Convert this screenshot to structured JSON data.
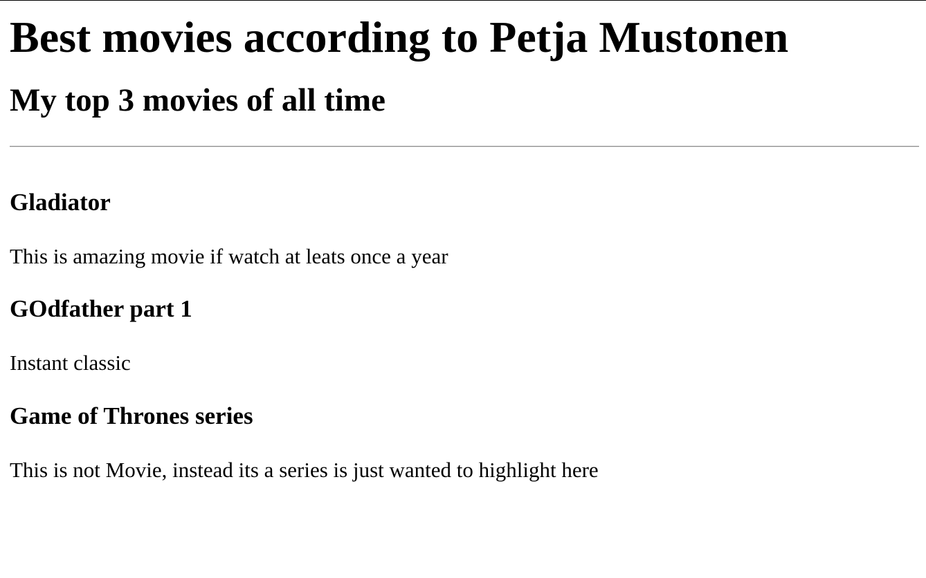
{
  "page": {
    "title": "Best movies according to Petja Mustonen",
    "subtitle": "My top 3 movies of all time"
  },
  "movies": [
    {
      "title": "Gladiator",
      "description": "This is amazing movie if watch at leats once a year"
    },
    {
      "title": "GOdfather part 1",
      "description": "Instant classic"
    },
    {
      "title": "Game of Thrones series",
      "description": "This is not Movie, instead its a series is just wanted to highlight here"
    }
  ]
}
